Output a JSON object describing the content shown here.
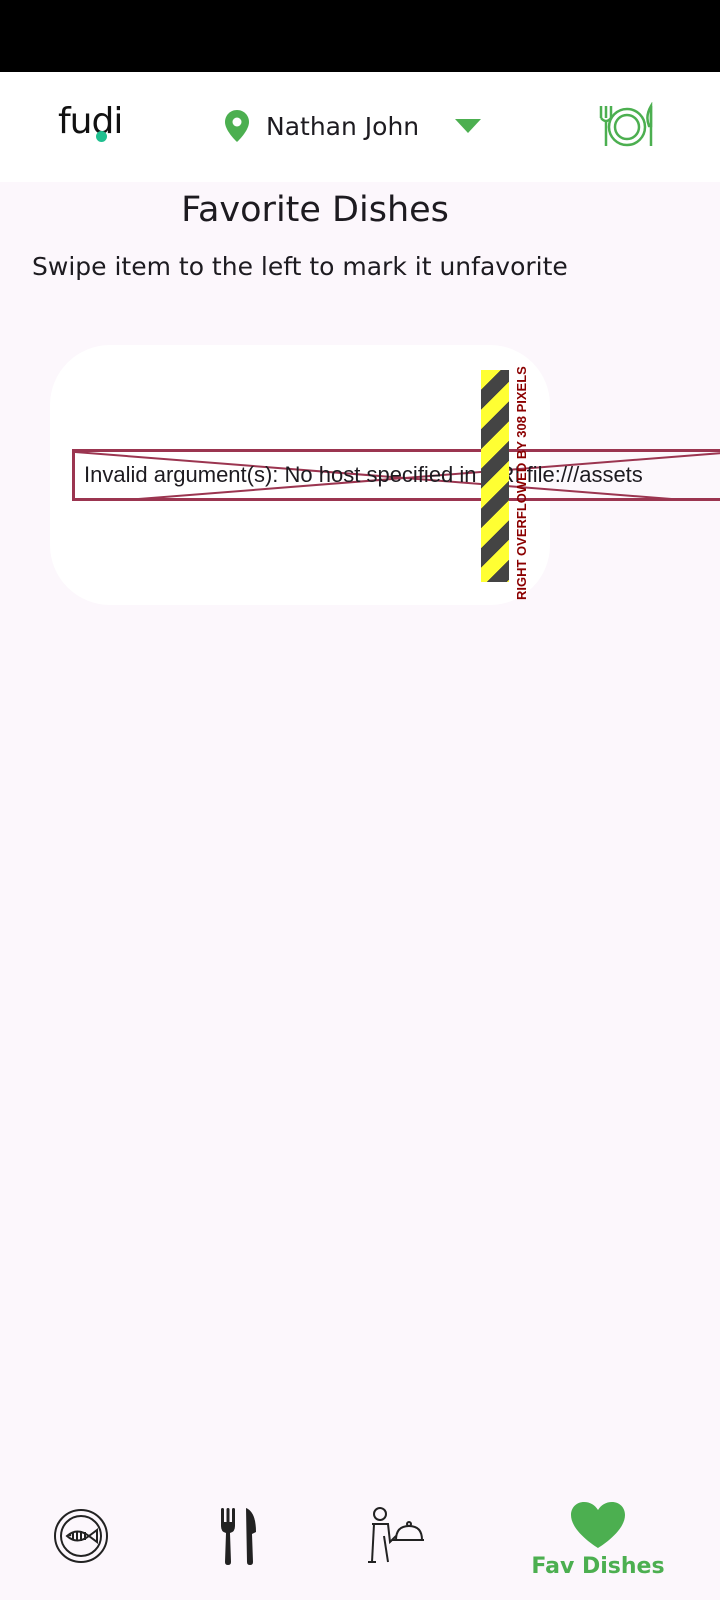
{
  "header": {
    "logo_text": "fudi",
    "location_icon": "location-pin-icon",
    "user_name": "Nathan John",
    "dropdown_icon": "caret-down-icon",
    "dish_icon": "plate-cutlery-icon"
  },
  "main": {
    "title": "Favorite Dishes",
    "subtitle": "Swipe item to the left to mark it unfavorite",
    "error_message": "Invalid argument(s): No host specified in URI file:///assets",
    "overflow_message": "RIGHT OVERFLOWED BY 308 PIXELS"
  },
  "bottom_nav": {
    "items": [
      {
        "icon": "fish-plate-icon",
        "label": ""
      },
      {
        "icon": "fork-knife-icon",
        "label": ""
      },
      {
        "icon": "waiter-icon",
        "label": ""
      },
      {
        "icon": "heart-icon",
        "label": "Fav Dishes"
      }
    ]
  },
  "colors": {
    "accent": "#4caf50",
    "background": "#fcf7fc",
    "error_border": "#9b3550",
    "status_bar": "#000000"
  }
}
